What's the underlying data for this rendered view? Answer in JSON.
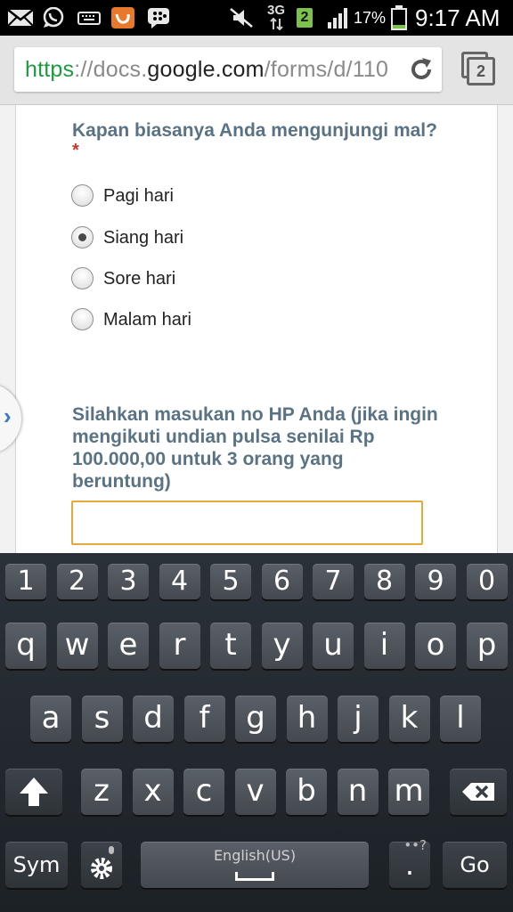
{
  "status_bar": {
    "network_label": "3G",
    "sim_badge": "2",
    "battery_percent": "17%",
    "time": "9:17 AM",
    "battery_level": 0.17,
    "icons": [
      "mail-icon",
      "whatsapp-icon",
      "keyboard-icon",
      "uc-browser-icon",
      "bbm-icon",
      "mute-icon",
      "data-arrows-icon",
      "signal-icon",
      "battery-icon"
    ]
  },
  "browser": {
    "url_scheme": "https",
    "url_sep": "://docs.",
    "url_host": "google.com",
    "url_path": "/forms/d/110",
    "tab_count": "2"
  },
  "form": {
    "question1": {
      "title": "Kapan biasanya Anda mengunjungi mal?",
      "required_mark": "*",
      "options": [
        {
          "label": "Pagi hari",
          "checked": false
        },
        {
          "label": "Siang hari",
          "checked": true
        },
        {
          "label": "Sore hari",
          "checked": false
        },
        {
          "label": "Malam hari",
          "checked": false
        }
      ]
    },
    "question2": {
      "title_lines": [
        "Silahkan masukan no HP Anda (jika ingin",
        "mengikuti undian pulsa senilai Rp",
        "100.000,00 untuk 3 orang yang",
        "beruntung)"
      ],
      "value": ""
    }
  },
  "keyboard": {
    "number_row": [
      "1",
      "2",
      "3",
      "4",
      "5",
      "6",
      "7",
      "8",
      "9",
      "0"
    ],
    "row1": [
      "q",
      "w",
      "e",
      "r",
      "t",
      "y",
      "u",
      "i",
      "o",
      "p"
    ],
    "row2": [
      "a",
      "s",
      "d",
      "f",
      "g",
      "h",
      "j",
      "k",
      "l"
    ],
    "row3": [
      "z",
      "x",
      "c",
      "v",
      "b",
      "n",
      "m"
    ],
    "sym_label": "Sym",
    "space_label": "English(US)",
    "period_label": ".",
    "period_hint": "••?",
    "go_label": "Go"
  }
}
